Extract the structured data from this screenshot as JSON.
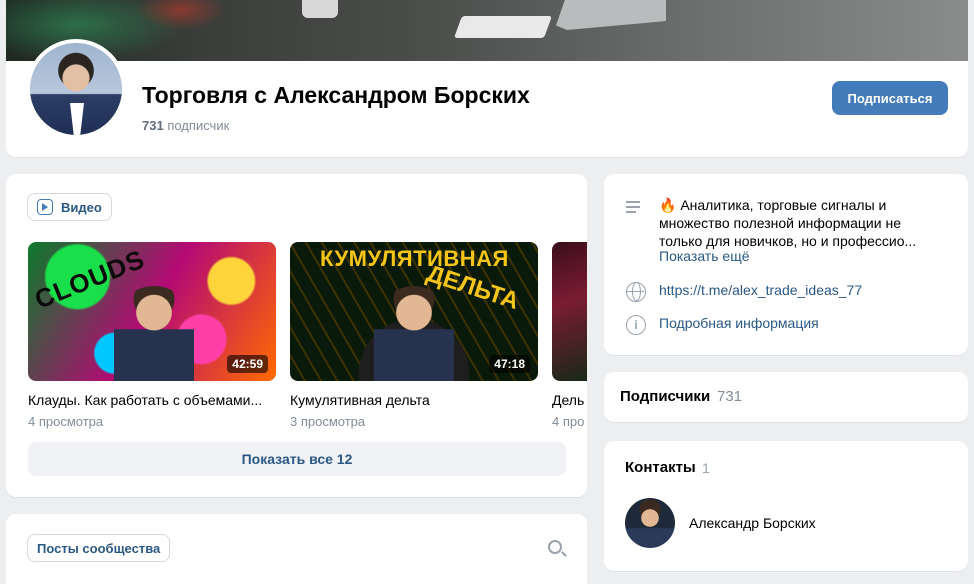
{
  "group": {
    "title": "Торговля с Александром Борских",
    "subscribers_count": "731",
    "subscribers_label": "подписчик",
    "subscribe_button": "Подписаться"
  },
  "videos": {
    "tab_label": "Видео",
    "items": [
      {
        "title": "Клауды. Как работать с объемами...",
        "views": "4 просмотра",
        "duration": "42:59",
        "thumb_text": "CLOUDS"
      },
      {
        "title": "Кумулятивная дельта",
        "views": "3 просмотра",
        "duration": "47:18",
        "thumb_text_top": "КУМУЛЯТИВНАЯ",
        "thumb_text_bottom": "ДЕЛЬТА"
      },
      {
        "title": "Дель",
        "views": "4 про"
      }
    ],
    "show_all": "Показать все 12"
  },
  "posts": {
    "tab_label": "Посты сообщества"
  },
  "info": {
    "description": "🔥 Аналитика, торговые сигналы и множество полезной информации не только для новичков, но и профессио...",
    "show_more": "Показать ещё",
    "link": "https://t.me/alex_trade_ideas_77",
    "details": "Подробная информация"
  },
  "subscribers_block": {
    "title": "Подписчики",
    "count": "731"
  },
  "contacts": {
    "title": "Контакты",
    "count": "1",
    "items": [
      {
        "name": "Александр Борских"
      }
    ]
  },
  "colors": {
    "accent": "#447bba",
    "link": "#2a5885",
    "background": "#edeef0"
  }
}
